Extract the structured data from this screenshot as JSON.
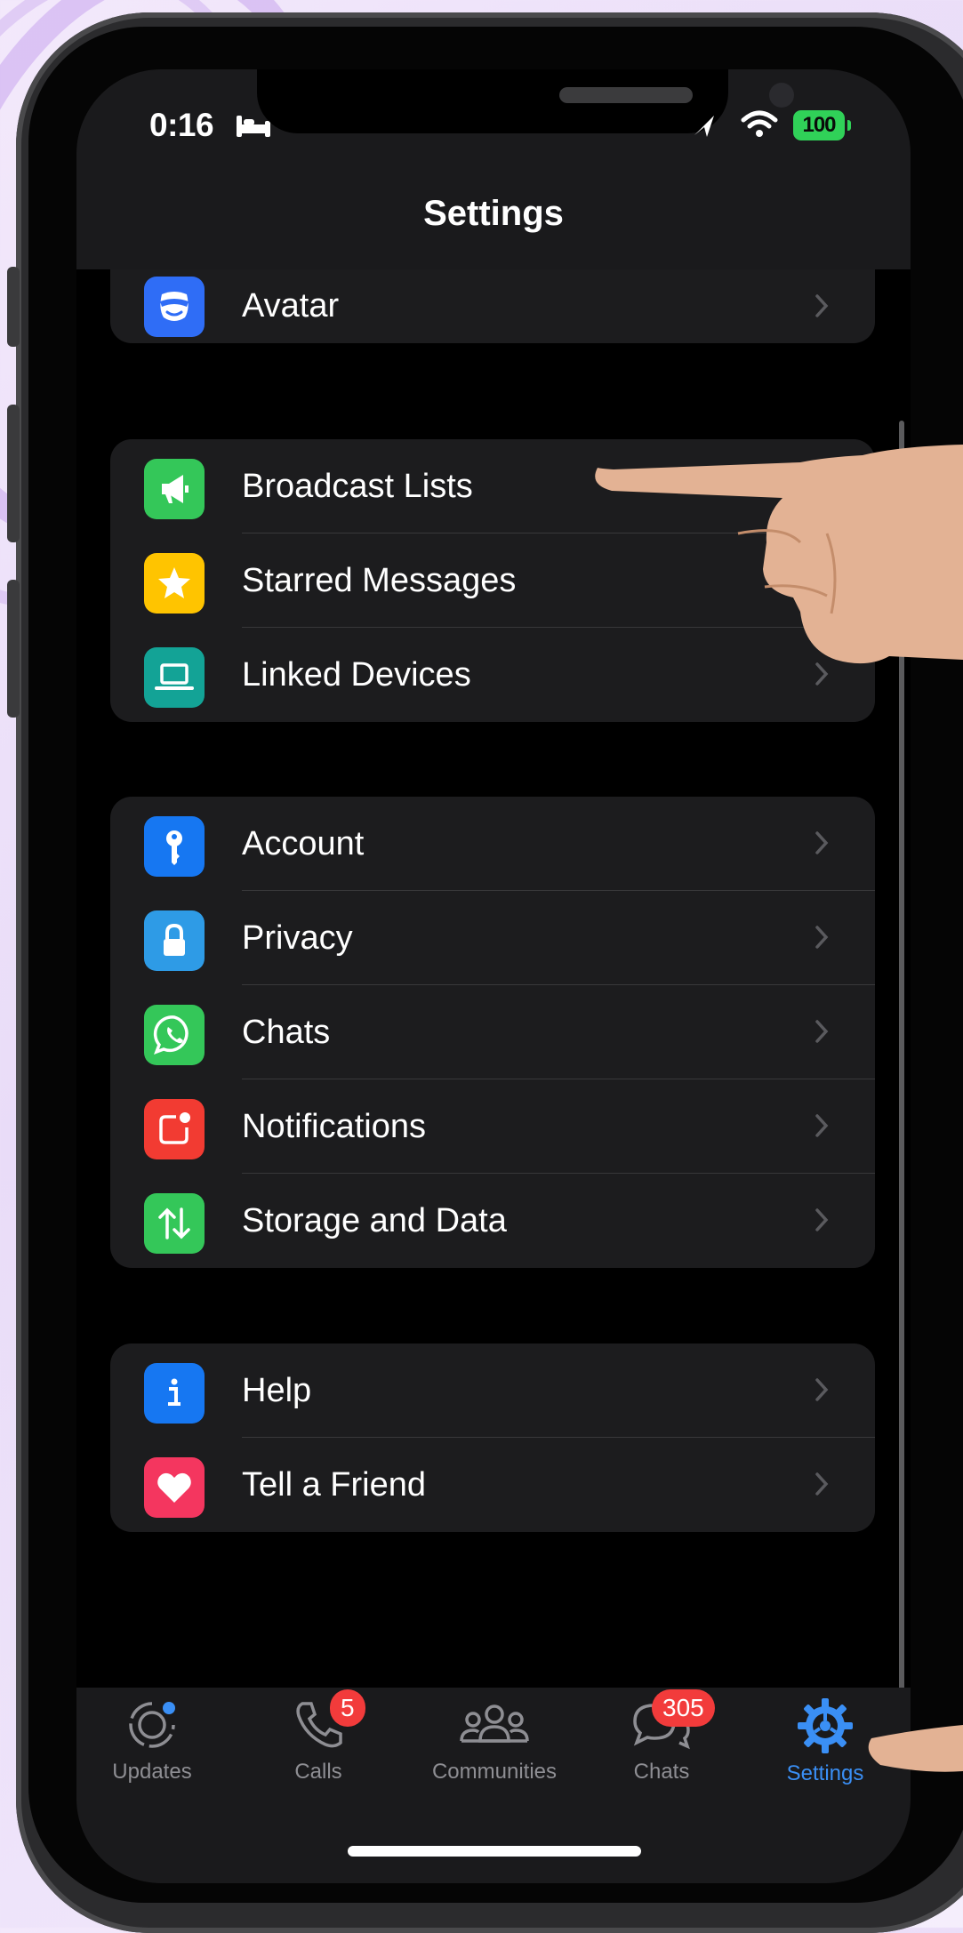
{
  "status": {
    "time": "0:16",
    "battery": "100"
  },
  "header": {
    "title": "Settings"
  },
  "groups": [
    {
      "rows": [
        {
          "label": "Avatar",
          "icon": "avatar-icon",
          "color": "#2f6df6"
        }
      ]
    },
    {
      "rows": [
        {
          "label": "Broadcast Lists",
          "icon": "megaphone-icon",
          "color": "#34c759"
        },
        {
          "label": "Starred Messages",
          "icon": "star-icon",
          "color": "#ffc400"
        },
        {
          "label": "Linked Devices",
          "icon": "laptop-icon",
          "color": "#13a396"
        }
      ]
    },
    {
      "rows": [
        {
          "label": "Account",
          "icon": "key-icon",
          "color": "#1677f2"
        },
        {
          "label": "Privacy",
          "icon": "lock-icon",
          "color": "#2e9be6"
        },
        {
          "label": "Chats",
          "icon": "whatsapp-icon",
          "color": "#34c759"
        },
        {
          "label": "Notifications",
          "icon": "notification-icon",
          "color": "#f23b32"
        },
        {
          "label": "Storage and Data",
          "icon": "arrows-updown-icon",
          "color": "#34c759"
        }
      ]
    },
    {
      "rows": [
        {
          "label": "Help",
          "icon": "info-icon",
          "color": "#1677f2"
        },
        {
          "label": "Tell a Friend",
          "icon": "heart-icon",
          "color": "#f4365f"
        }
      ]
    }
  ],
  "tabs": [
    {
      "label": "Updates",
      "icon": "updates-icon",
      "badge": ""
    },
    {
      "label": "Calls",
      "icon": "phone-icon",
      "badge": "5"
    },
    {
      "label": "Communities",
      "icon": "communities-icon",
      "badge": ""
    },
    {
      "label": "Chats",
      "icon": "chat-bubbles-icon",
      "badge": "305"
    },
    {
      "label": "Settings",
      "icon": "settings-gear-icon",
      "badge": "",
      "active": true
    }
  ],
  "colors": {
    "accent": "#3a8ff5",
    "badge": "#f23b3b"
  }
}
